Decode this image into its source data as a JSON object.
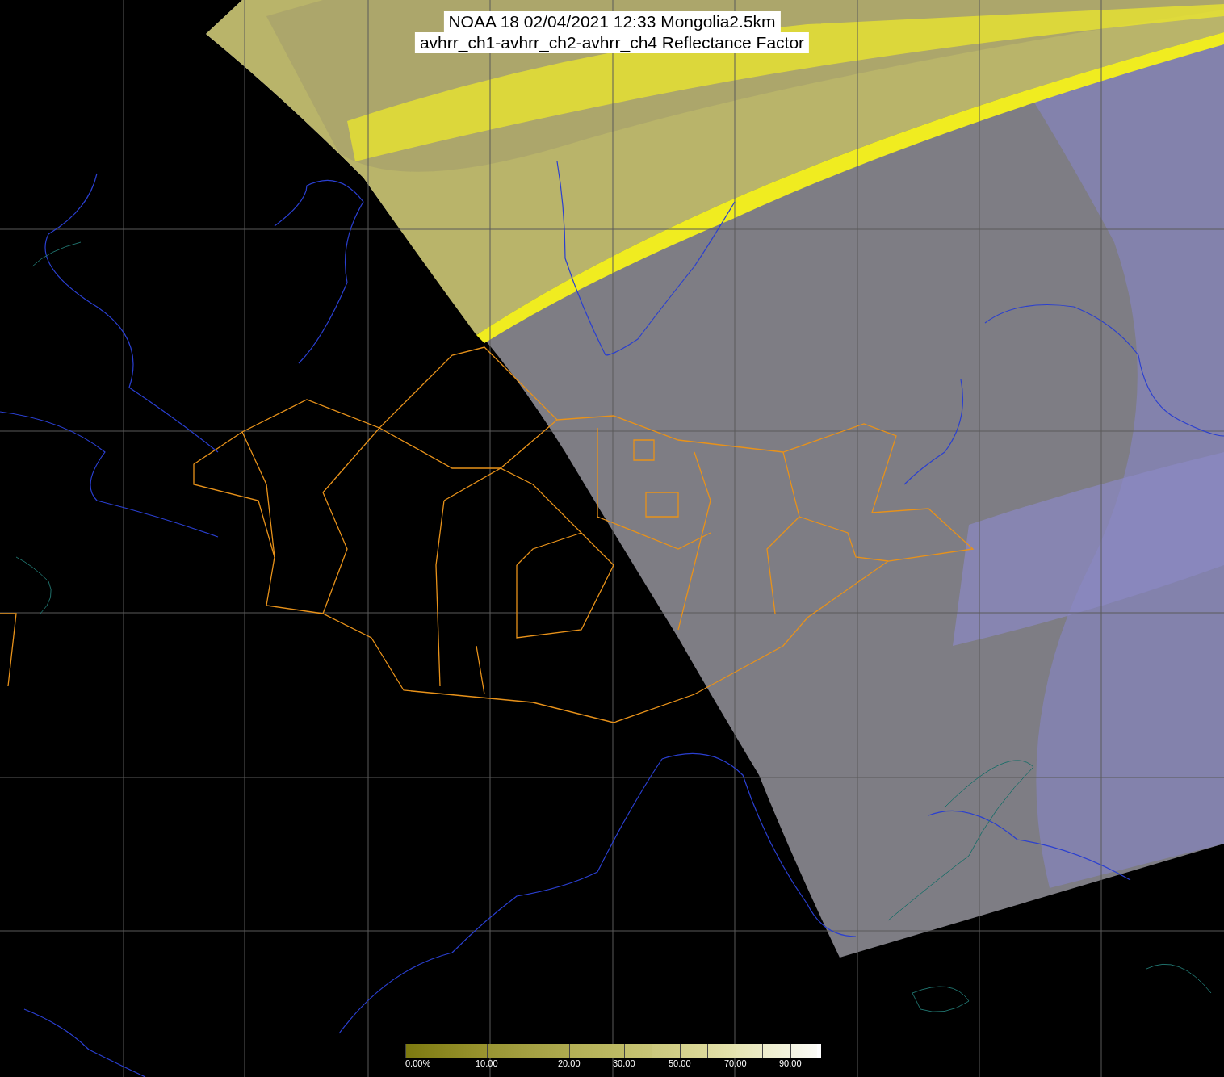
{
  "title": {
    "lines": [
      "NOAA 18 02/04/2021 12:33 Mongolia2.5km",
      "avhrr_ch1-avhrr_ch2-avhrr_ch4 Reflectance Factor"
    ]
  },
  "colorbar": {
    "labels": [
      "0.00%",
      "10.00",
      "20.00",
      "30.00",
      "50.00",
      "70.00",
      "90.00"
    ]
  }
}
